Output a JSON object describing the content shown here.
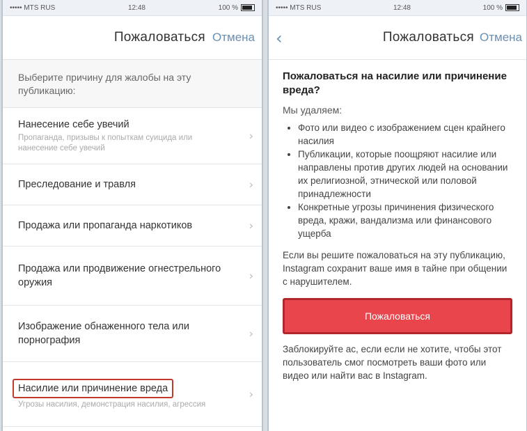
{
  "left": {
    "status": {
      "carrier": "••••• MTS RUS",
      "time": "12:48",
      "battery": "100 %"
    },
    "nav": {
      "title": "Пожаловаться",
      "cancel": "Отмена"
    },
    "prompt": "Выберите причину для жалобы на эту публикацию:",
    "items": [
      {
        "label": "Нанесение себе увечий",
        "sub": "Пропаганда, призывы к попыткам суицида или нанесение себе увечий"
      },
      {
        "label": "Преследование и травля",
        "sub": ""
      },
      {
        "label": "Продажа или пропаганда наркотиков",
        "sub": ""
      },
      {
        "label": "Продажа или продвижение огнестрельного оружия",
        "sub": ""
      },
      {
        "label": "Изображение обнаженного тела или порнография",
        "sub": ""
      },
      {
        "label": "Насилие или причинение вреда",
        "sub": "Угрозы насилия, демонстрация насилия, агрессия"
      }
    ]
  },
  "right": {
    "status": {
      "carrier": "••••• MTS RUS",
      "time": "12:48",
      "battery": "100 %"
    },
    "nav": {
      "back": "‹",
      "title": "Пожаловаться",
      "cancel": "Отмена"
    },
    "title": "Пожаловаться на насилие или причинение вреда?",
    "intro": "Мы удаляем:",
    "bullets": [
      "Фото или видео с изображением сцен крайнего насилия",
      "Публикации, которые поощряют насилие или направлены против других людей на основании их религиозной, этнической или половой принадлежности",
      "Конкретные угрозы причинения физического вреда, кражи, вандализма или финансового ущерба"
    ],
    "note": "Если вы решите пожаловаться на эту публикацию, Instagram сохранит ваше имя в тайне при общении с нарушителем.",
    "button": "Пожаловаться",
    "block": "Заблокируйте ac, если если не хотите, чтобы этот пользователь смог посмотреть ваши фото или видео или найти вас в Instagram."
  }
}
